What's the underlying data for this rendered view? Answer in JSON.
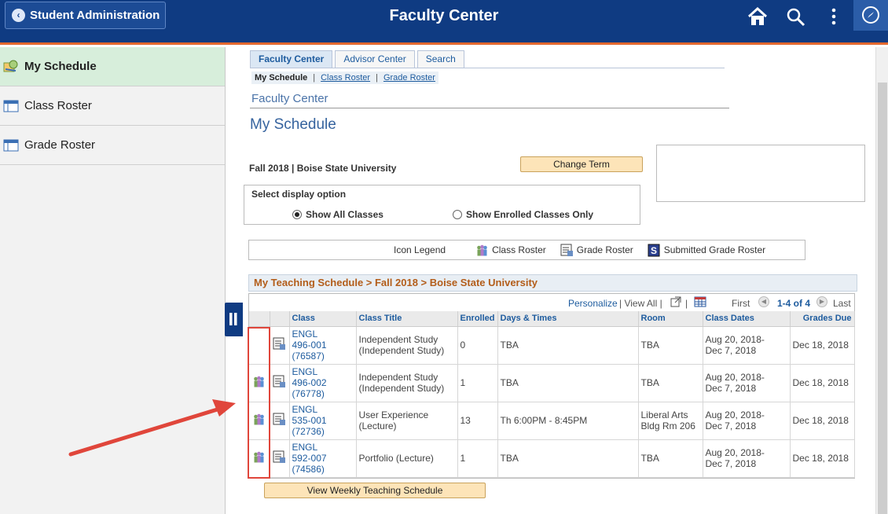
{
  "header": {
    "back_label": "Student Administration",
    "title": "Faculty Center"
  },
  "sidebar": {
    "items": [
      {
        "label": "My Schedule"
      },
      {
        "label": "Class Roster"
      },
      {
        "label": "Grade Roster"
      }
    ]
  },
  "tabs": [
    "Faculty Center",
    "Advisor Center",
    "Search"
  ],
  "subnav": {
    "current": "My Schedule",
    "links": [
      "Class Roster",
      "Grade Roster"
    ]
  },
  "section_label": "Faculty Center",
  "page_title": "My Schedule",
  "term_text": "Fall 2018 | Boise State University",
  "change_term_label": "Change Term",
  "display": {
    "label": "Select display option",
    "opt_all": "Show All Classes",
    "opt_enrolled": "Show Enrolled Classes Only"
  },
  "legend": {
    "title": "Icon Legend",
    "class_roster": "Class Roster",
    "grade_roster": "Grade Roster",
    "submitted": "Submitted Grade Roster"
  },
  "grid": {
    "title": "My Teaching Schedule > Fall 2018 > Boise State University",
    "personalize": "Personalize",
    "view_all": "View All",
    "first": "First",
    "range": "1-4 of 4",
    "last": "Last",
    "headers": [
      "Class",
      "Class Title",
      "Enrolled",
      "Days & Times",
      "Room",
      "Class Dates",
      "Grades Due"
    ],
    "rows": [
      {
        "class": "ENGL 496-001 (76587)",
        "l1": "ENGL",
        "l2": "496-001",
        "l3": "(76587)",
        "title1": "Independent Study",
        "title2": "(Independent Study)",
        "enrolled": "0",
        "days": "TBA",
        "room1": "TBA",
        "room2": "",
        "date1": "Aug 20, 2018-",
        "date2": "Dec 7, 2018",
        "due": "Dec 18, 2018"
      },
      {
        "class": "ENGL 496-002 (76778)",
        "l1": "ENGL",
        "l2": "496-002",
        "l3": "(76778)",
        "title1": "Independent Study",
        "title2": "(Independent Study)",
        "enrolled": "1",
        "days": "TBA",
        "room1": "TBA",
        "room2": "",
        "date1": "Aug 20, 2018-",
        "date2": "Dec 7, 2018",
        "due": "Dec 18, 2018"
      },
      {
        "class": "ENGL 535-001 (72736)",
        "l1": "ENGL",
        "l2": "535-001",
        "l3": "(72736)",
        "title1": "User Experience",
        "title2": "(Lecture)",
        "enrolled": "13",
        "days": "Th 6:00PM - 8:45PM",
        "room1": "Liberal Arts",
        "room2": "Bldg Rm 206",
        "date1": "Aug 20, 2018-",
        "date2": "Dec 7, 2018",
        "due": "Dec 18, 2018"
      },
      {
        "class": "ENGL 592-007 (74586)",
        "l1": "ENGL",
        "l2": "592-007",
        "l3": "(74586)",
        "title1": "Portfolio (Lecture)",
        "title2": "",
        "enrolled": "1",
        "days": "TBA",
        "room1": "TBA",
        "room2": "",
        "date1": "Aug 20, 2018-",
        "date2": "Dec 7, 2018",
        "due": "Dec 18, 2018"
      }
    ]
  },
  "weekly_button": "View Weekly Teaching Schedule",
  "annotation_color": "#e0463b",
  "brand_color": "#0f3b82"
}
